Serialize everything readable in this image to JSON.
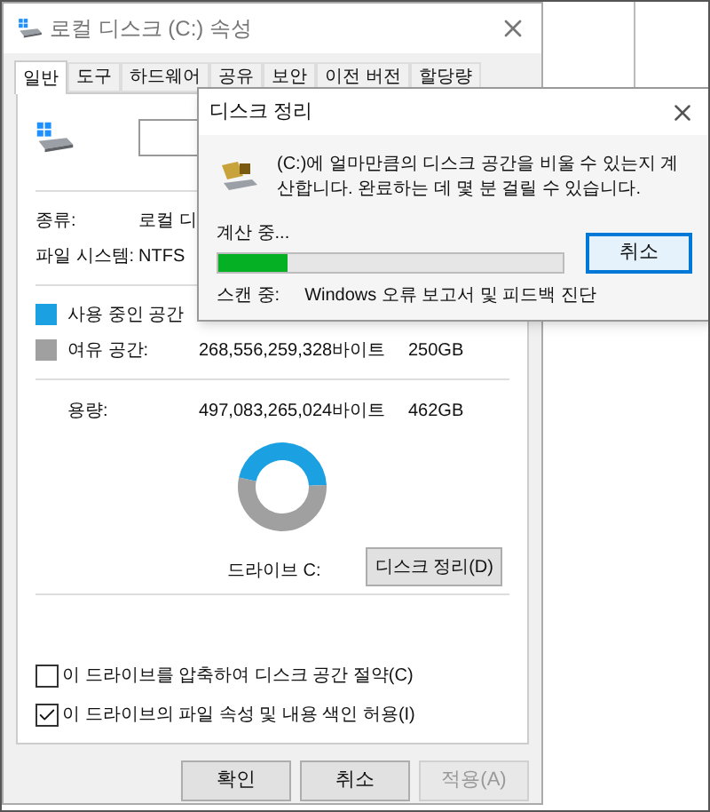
{
  "window": {
    "title": "로컬 디스크 (C:) 속성"
  },
  "tabs": [
    {
      "label": "일반",
      "selected": true
    },
    {
      "label": "도구",
      "selected": false
    },
    {
      "label": "하드웨어",
      "selected": false
    },
    {
      "label": "공유",
      "selected": false
    },
    {
      "label": "보안",
      "selected": false
    },
    {
      "label": "이전 버전",
      "selected": false
    },
    {
      "label": "할당량",
      "selected": false
    }
  ],
  "info": [
    {
      "label": "종류:",
      "value": "로컬 디"
    },
    {
      "label": "파일 시스템:",
      "value": "NTFS"
    }
  ],
  "legend": [
    {
      "label": "사용 중인 공간",
      "color": "#1ba1e2"
    },
    {
      "label": "여유 공간:",
      "color": "#a0a0a0",
      "bytes": "268,556,259,328바이트",
      "size": "250GB"
    }
  ],
  "capacity": {
    "label": "용량:",
    "bytes": "497,083,265,024바이트",
    "size": "462GB"
  },
  "usage": {
    "chart_data": {
      "type": "donut",
      "values": [
        46,
        54
      ]
    }
  },
  "drive_label": "드라이브 C:",
  "cleanup_button": "디스크 정리(D)",
  "options": [
    {
      "label": "이 드라이브를 압축하여 디스크 공간 절약(C)",
      "checked": false
    },
    {
      "label": "이 드라이브의 파일 속성 및 내용 색인 허용(I)",
      "checked": true
    }
  ],
  "buttons": [
    {
      "label": "확인",
      "disabled": false
    },
    {
      "label": "취소",
      "disabled": false
    },
    {
      "label": "적용(A)",
      "disabled": true
    }
  ],
  "dialog": {
    "title": "디스크 정리",
    "message": "(C:)에 얼마만큼의 디스크 공간을 비울 수 있는지 계산합니다. 완료하는 데 몇 분 걸릴 수 있습니다.",
    "status": "계산 중...",
    "progress": {
      "level": 0.2
    },
    "cancel": "취소",
    "scan_label": "스캔 중:",
    "scan_item": "Windows 오류 보고서 및 피드백 진단"
  }
}
